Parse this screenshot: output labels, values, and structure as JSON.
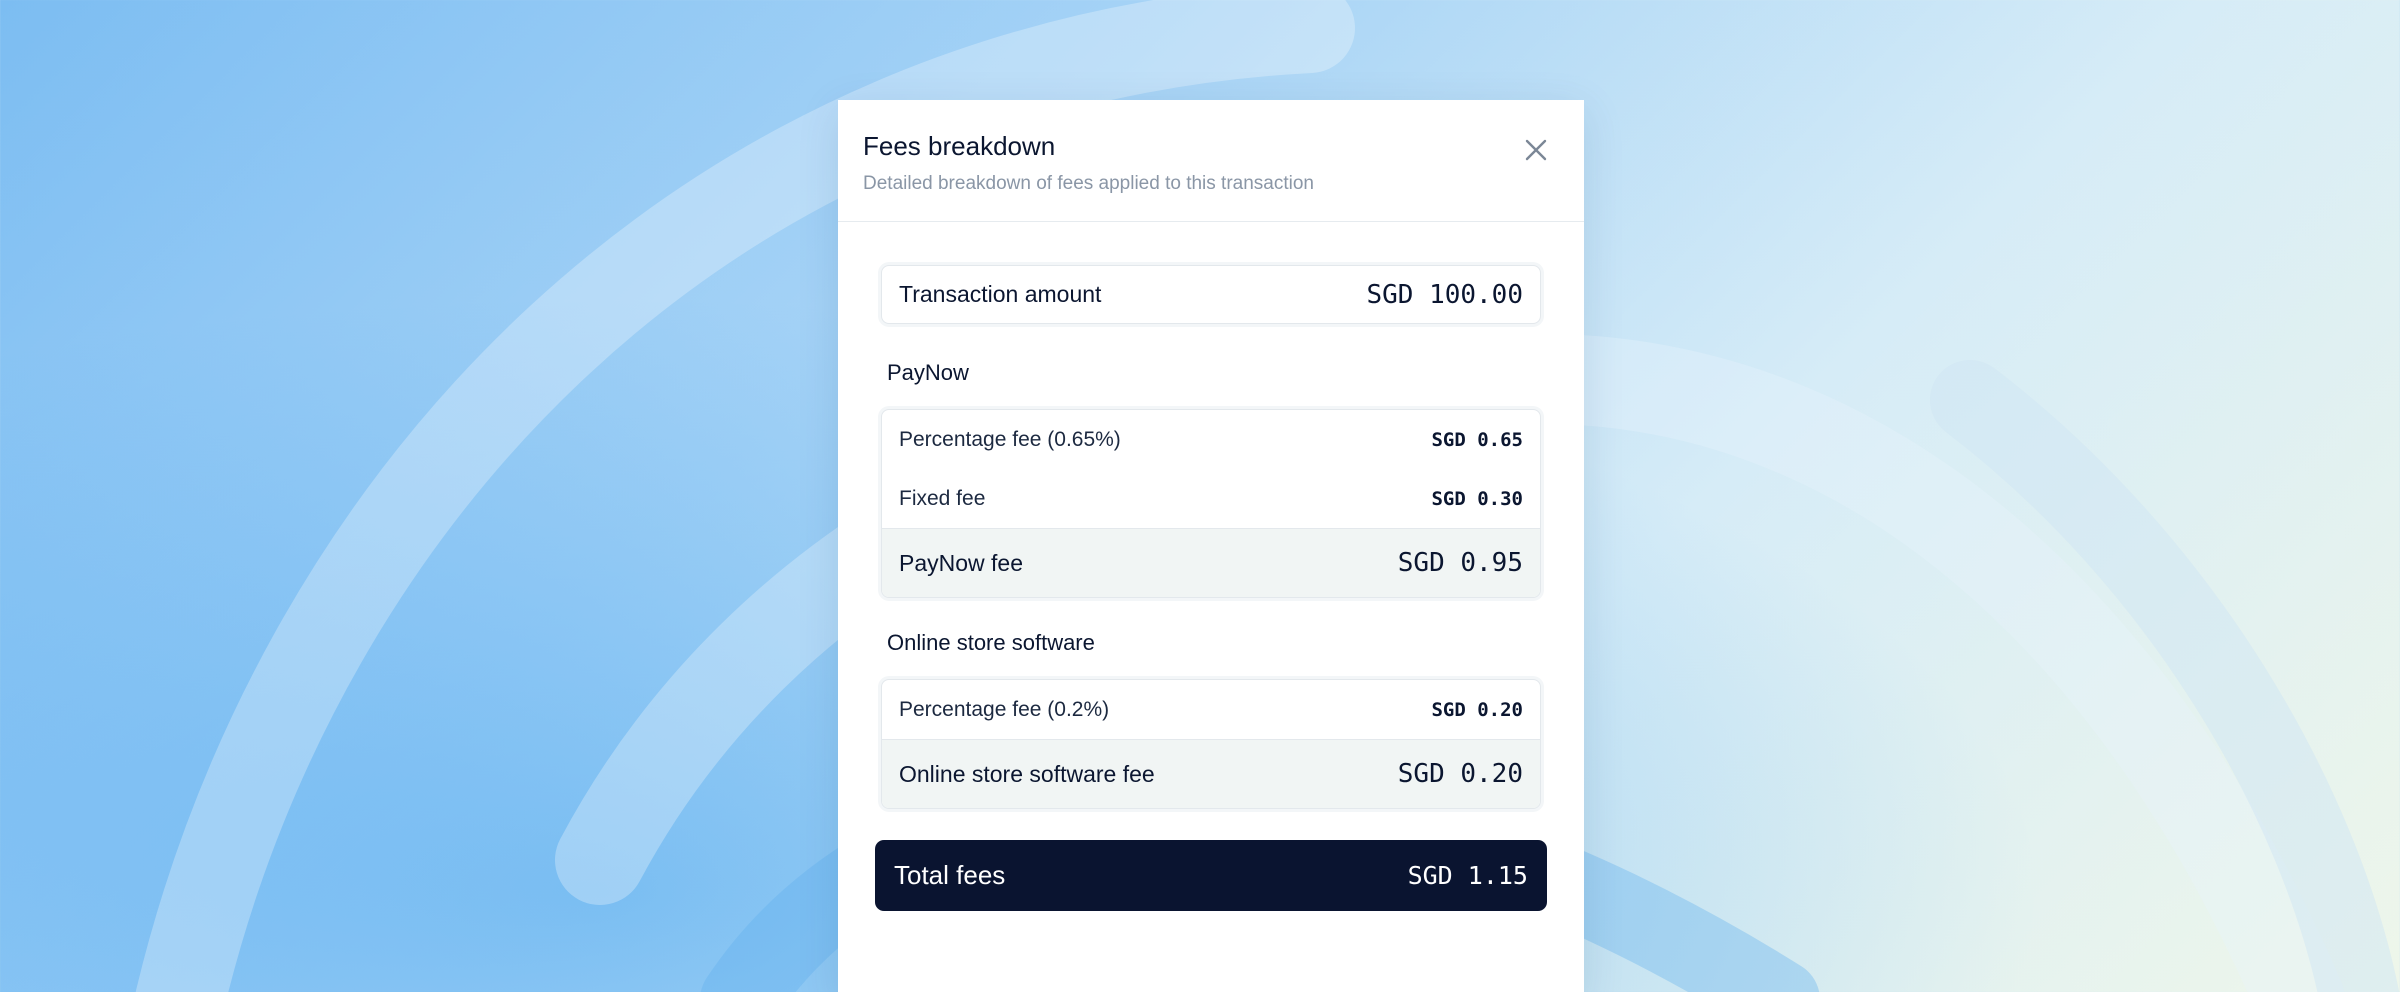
{
  "colors": {
    "accent_dark": "#0a1430",
    "subtotal_bg": "#f1f5f4",
    "text_primary": "#0b1630",
    "text_muted": "#8a96a6"
  },
  "modal": {
    "title": "Fees breakdown",
    "subtitle": "Detailed breakdown of fees applied to this transaction",
    "close_icon": "close-icon"
  },
  "transaction": {
    "label": "Transaction amount",
    "value": "SGD 100.00"
  },
  "paynow": {
    "title": "PayNow",
    "rows": [
      {
        "label": "Percentage fee (0.65%)",
        "value": "SGD 0.65"
      },
      {
        "label": "Fixed fee",
        "value": "SGD 0.30"
      }
    ],
    "subtotal": {
      "label": "PayNow fee",
      "value": "SGD 0.95"
    }
  },
  "store": {
    "title": "Online store software",
    "rows": [
      {
        "label": "Percentage fee (0.2%)",
        "value": "SGD 0.20"
      }
    ],
    "subtotal": {
      "label": "Online store software fee",
      "value": "SGD 0.20"
    }
  },
  "total": {
    "label": "Total fees",
    "value": "SGD 1.15"
  }
}
